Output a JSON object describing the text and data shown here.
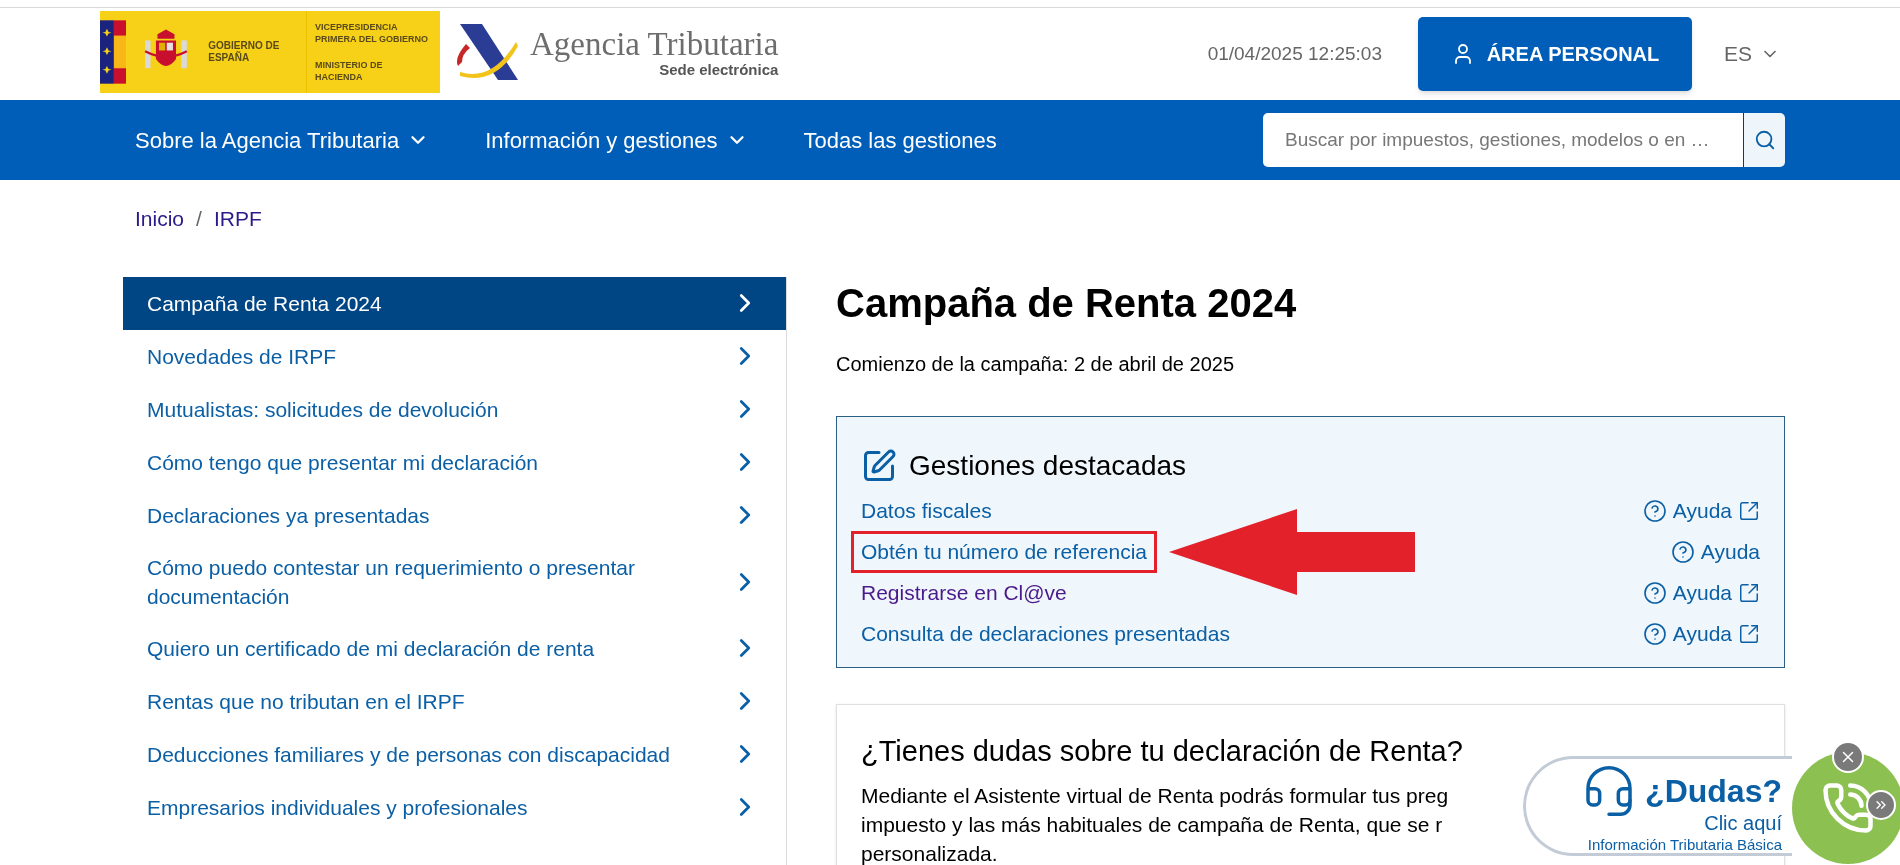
{
  "header": {
    "gov_logo": {
      "name": "GOBIERNO DE ESPAÑA",
      "department_1": "VICEPRESIDENCIA PRIMERA DEL GOBIERNO",
      "department_2": "MINISTERIO DE HACIENDA"
    },
    "agency_logo": {
      "name": "Agencia Tributaria",
      "subtitle": "Sede electrónica"
    },
    "datetime": "01/04/2025 12:25:03",
    "personal_button": "ÁREA PERSONAL",
    "language": "ES"
  },
  "nav": {
    "items": [
      {
        "label": "Sobre la Agencia Tributaria",
        "dropdown": true
      },
      {
        "label": "Información y gestiones",
        "dropdown": true
      },
      {
        "label": "Todas las gestiones",
        "dropdown": false
      }
    ],
    "search": {
      "placeholder": "Buscar por impuestos, gestiones, modelos o en …"
    }
  },
  "breadcrumb": {
    "separator": "/",
    "items": [
      "Inicio",
      "IRPF"
    ]
  },
  "sidebar": {
    "items": [
      {
        "label": "Campaña de Renta 2024",
        "selected": true
      },
      {
        "label": "Novedades de IRPF",
        "selected": false
      },
      {
        "label": "Mutualistas: solicitudes de devolución",
        "selected": false
      },
      {
        "label": "Cómo tengo que presentar mi declaración",
        "selected": false
      },
      {
        "label": "Declaraciones ya presentadas",
        "selected": false
      },
      {
        "label": "Cómo puedo contestar un requerimiento o presentar documentación",
        "selected": false
      },
      {
        "label": "Quiero un certificado de mi declaración de renta",
        "selected": false
      },
      {
        "label": "Rentas que no tributan en el IRPF",
        "selected": false
      },
      {
        "label": "Deducciones familiares y de personas con discapacidad",
        "selected": false
      },
      {
        "label": "Empresarios individuales y profesionales",
        "selected": false
      }
    ]
  },
  "main": {
    "title": "Campaña de Renta 2024",
    "subtitle": "Comienzo de la campaña: 2 de abril de 2025",
    "featured": {
      "heading": "Gestiones destacadas",
      "items": [
        {
          "label": "Datos fiscales",
          "visited": false,
          "highlighted": false,
          "help": "Ayuda",
          "external": true
        },
        {
          "label": "Obtén tu número de referencia",
          "visited": false,
          "highlighted": true,
          "help": "Ayuda",
          "external": false
        },
        {
          "label": "Registrarse en Cl@ve",
          "visited": true,
          "highlighted": false,
          "help": "Ayuda",
          "external": true
        },
        {
          "label": "Consulta de declaraciones presentadas",
          "visited": false,
          "highlighted": false,
          "help": "Ayuda",
          "external": true
        }
      ]
    },
    "questions": {
      "heading": "¿Tienes dudas sobre tu declaración de Renta?",
      "lines": [
        "Mediante el Asistente virtual de Renta podrás formular tus preg",
        "impuesto y las más habituales de campaña de Renta, que se r",
        "personalizada."
      ]
    }
  },
  "help_widget": {
    "title": "¿Dudas?",
    "action": "Clic aquí",
    "caption": "Información Tributaria Básica"
  }
}
